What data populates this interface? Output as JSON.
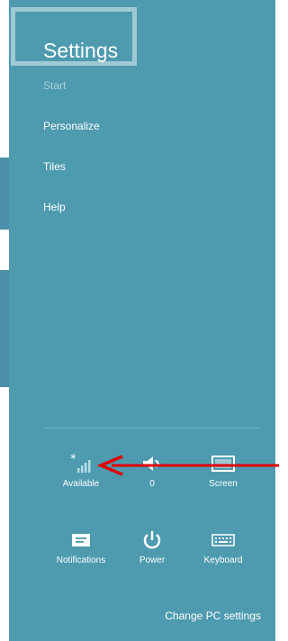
{
  "charm": {
    "title": "Settings",
    "menu": [
      {
        "label": "Start"
      },
      {
        "label": "Personalize"
      },
      {
        "label": "Tiles"
      },
      {
        "label": "Help"
      }
    ]
  },
  "quick_settings": [
    {
      "label": "Available",
      "icon": "network-signal-icon"
    },
    {
      "label": "0",
      "icon": "volume-icon"
    },
    {
      "label": "Screen",
      "icon": "screen-brightness-icon"
    },
    {
      "label": "Notifications",
      "icon": "notifications-icon"
    },
    {
      "label": "Power",
      "icon": "power-icon"
    },
    {
      "label": "Keyboard",
      "icon": "keyboard-icon"
    }
  ],
  "footer": {
    "change_pc_settings": "Change PC settings"
  },
  "colors": {
    "charm_background": "#4e9bb0",
    "annotation_arrow": "#e00000"
  }
}
